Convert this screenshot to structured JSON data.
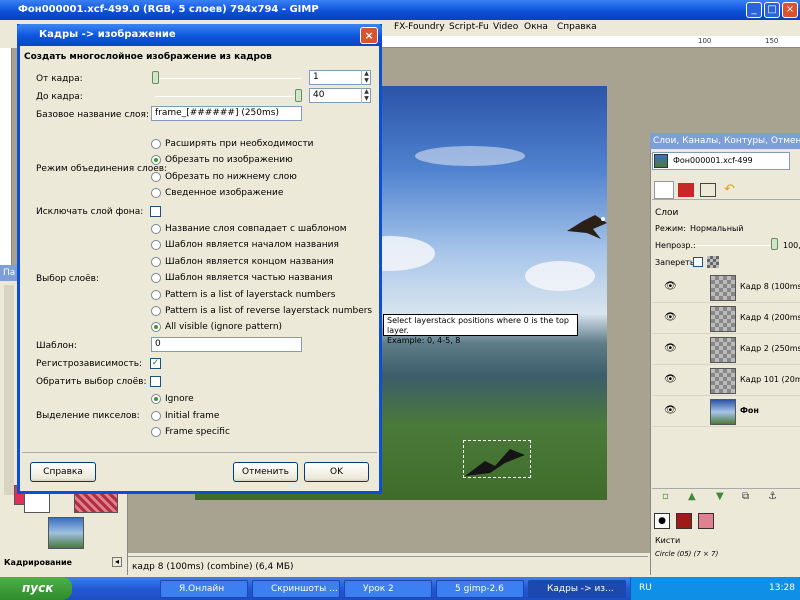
{
  "gimp": {
    "title": "Фон000001.xcf-499.0 (RGB, 5 слоев) 794x794 - GIMP",
    "menu": [
      "FX-Foundry",
      "Script-Fu",
      "Video",
      "Окна",
      "Справка"
    ],
    "ruler_ticks": [
      "100",
      "150"
    ],
    "status": "кадр 8 (100ms) (combine) (6,4 МБ)"
  },
  "dialog": {
    "title": "Кадры -> изображение",
    "heading": "Создать многослойное изображение из кадров",
    "from_label": "От кадра:",
    "from_value": "1",
    "to_label": "До кадра:",
    "to_value": "40",
    "basename_label": "Базовое название слоя:",
    "basename_value": "frame_[######] (250ms)",
    "merge_label": "Режим объединения слоев:",
    "merge_options": [
      "Расширять при необходимости",
      "Обрезать по изображению",
      "Обрезать по нижнему слою",
      "Сведенное изображение"
    ],
    "exclude_bg_label": "Исключать слой фона:",
    "select_label": "Выбор слоёв:",
    "select_options": [
      "Название слоя совпадает с шаблоном",
      "Шаблон является началом названия",
      "Шаблон является концом названия",
      "Шаблон является частью названия",
      "Pattern is a list of layerstack numbers",
      "Pattern is a list of reverse layerstack numbers",
      "All visible (ignore pattern)"
    ],
    "pattern_label": "Шаблон:",
    "pattern_value": "0",
    "case_label": "Регистрозависимость:",
    "invert_label": "Обратить выбор слоёв:",
    "pixel_label": "Выделение пикселов:",
    "pixel_options": [
      "Ignore",
      "Initial frame",
      "Frame specific"
    ],
    "help_button": "Справка",
    "cancel_button": "Отменить",
    "ok_button": "OK"
  },
  "tooltip": {
    "line1": "Select layerstack positions where 0 is the top layer.",
    "line2": "Example: 0, 4-5, 8"
  },
  "toolbox": {
    "title": "Па",
    "footer": "Кадрирование"
  },
  "layers": {
    "title": "Слои, Каналы, Контуры, Отмен...",
    "image_select": "Фон000001.xcf-499",
    "tab_label": "Слои",
    "mode_label": "Режим:",
    "mode_value": "Нормальный",
    "opacity_label": "Непрозр.:",
    "opacity_value": "100,0",
    "lock_label": "Запереть:",
    "items": [
      "Кадр 8 (100ms) (c",
      "Кадр 4 (200ms) (r",
      "Кадр 2 (250ms) (r",
      "Кадр 101 (20ms) (r",
      "Фон"
    ],
    "brushes_label": "Кисти",
    "brush_name": "Circle (05) (7 × 7)"
  },
  "taskbar": {
    "start": "пуск",
    "tasks": [
      "Я.Онлайн",
      "Скриншоты ...",
      "Урок 2",
      "5 gimp-2.6",
      "Кадры -> из..."
    ],
    "lang": "RU",
    "time": "13:28"
  },
  "colors": {
    "xp_blue": "#0a4fd6",
    "start_green": "#2e8c2a",
    "close_red": "#d9532c"
  }
}
